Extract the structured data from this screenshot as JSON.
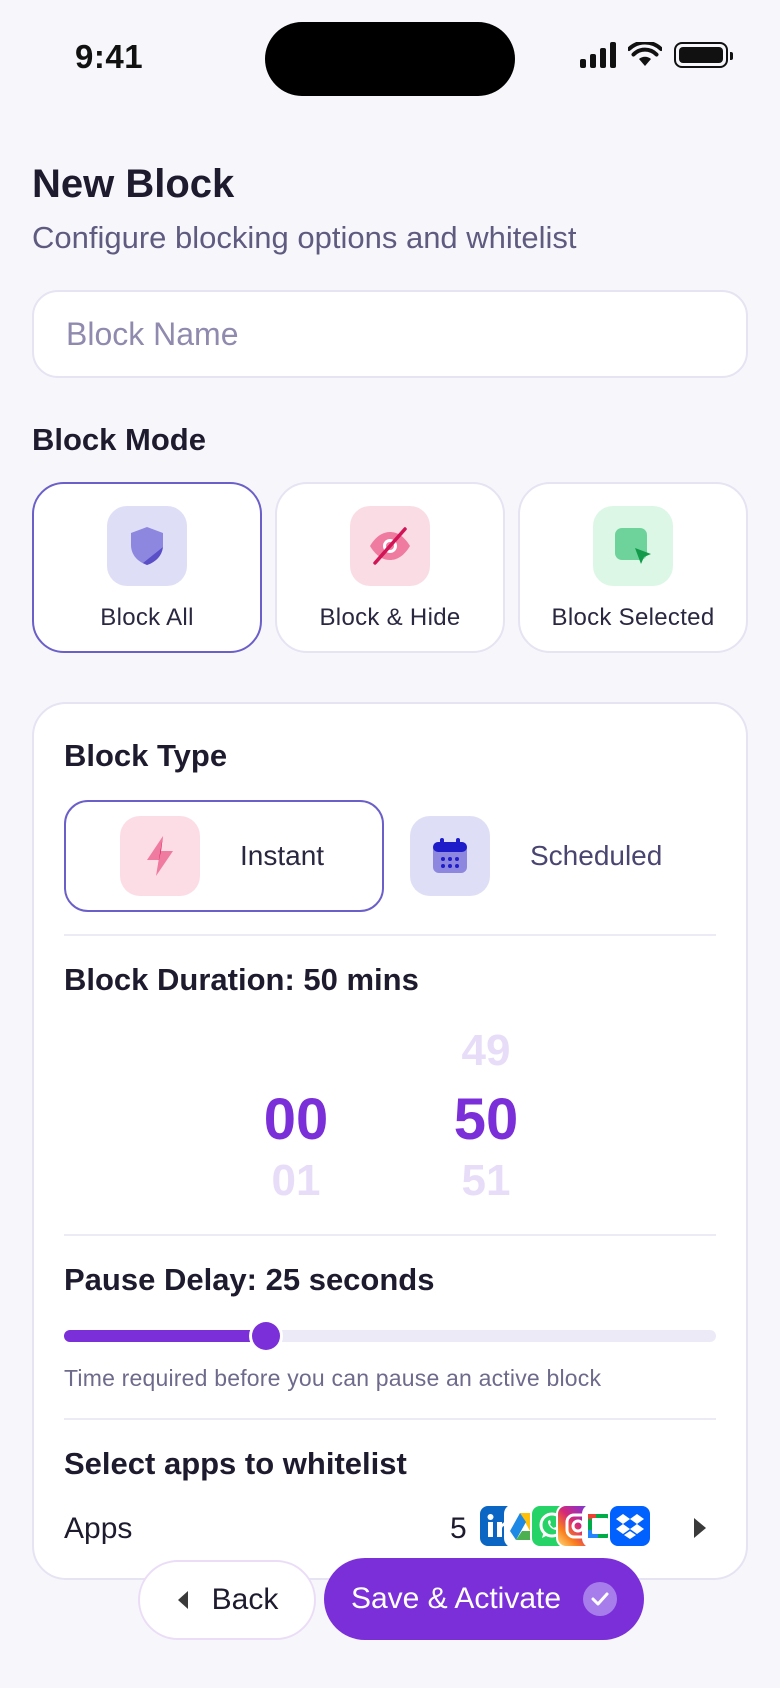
{
  "status_bar": {
    "time": "9:41"
  },
  "header": {
    "title": "New Block",
    "subtitle": "Configure blocking options and whitelist"
  },
  "name_field": {
    "value": "",
    "placeholder": "Block Name"
  },
  "block_mode": {
    "label": "Block Mode",
    "selected": "block-all",
    "options": [
      {
        "label": "Block All",
        "icon": "shield-icon"
      },
      {
        "label": "Block & Hide",
        "icon": "eye-off-icon"
      },
      {
        "label": "Block Selected",
        "icon": "cursor-select-icon"
      }
    ]
  },
  "block_type": {
    "label": "Block Type",
    "selected": "instant",
    "options": [
      {
        "label": "Instant",
        "icon": "lightning-icon"
      },
      {
        "label": "Scheduled",
        "icon": "calendar-icon"
      }
    ]
  },
  "duration": {
    "label": "Block Duration: 50 mins",
    "hours": {
      "prev": "",
      "current": "00",
      "next": "01"
    },
    "minutes": {
      "prev": "49",
      "current": "50",
      "next": "51"
    }
  },
  "pause_delay": {
    "label": "Pause Delay: 25 seconds",
    "fraction": 0.31,
    "hint": "Time required before you can pause an active block"
  },
  "whitelist": {
    "label": "Select apps to whitelist",
    "apps_label": "Apps",
    "count": "5",
    "apps": [
      "linkedin-icon",
      "google-drive-icon",
      "whatsapp-icon",
      "instagram-icon",
      "google-meet-icon",
      "dropbox-icon"
    ]
  },
  "actions": {
    "back_label": "Back",
    "save_label": "Save & Activate"
  },
  "colors": {
    "accent": "#7B2FD9",
    "selected_border": "#6B5FC9",
    "background": "#F7F7FB"
  }
}
